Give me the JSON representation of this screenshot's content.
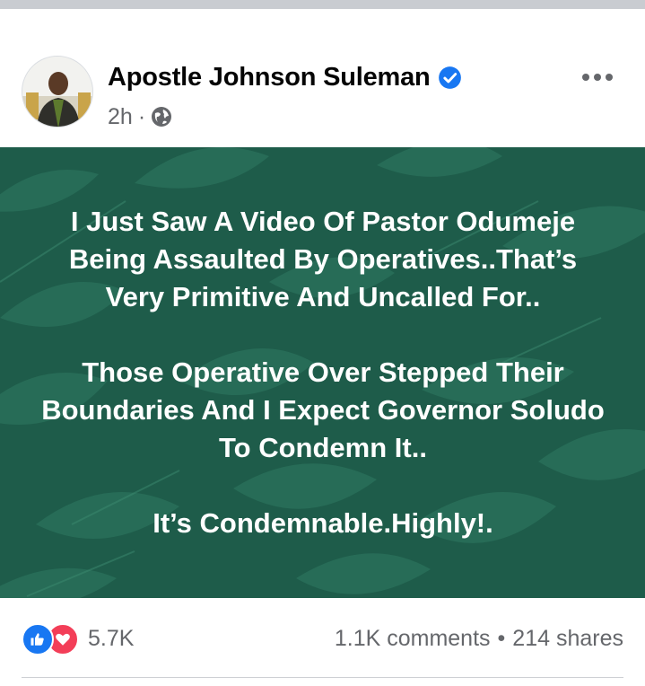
{
  "post": {
    "author": "Apostle Johnson Suleman",
    "time": "2h",
    "separator": "·",
    "more_label": "•••",
    "verified_icon": "verified-badge-icon",
    "privacy_icon": "globe-icon",
    "background_color": "#1e5c4a",
    "text_paragraphs": [
      "I Just Saw A Video Of Pastor Odumeje Being Assaulted By Operatives..That’s Very Primitive And Uncalled For..",
      "Those Operative Over Stepped Their Boundaries And I Expect Governor Soludo To Condemn It..",
      "It’s Condemnable.Highly!."
    ]
  },
  "footer": {
    "reaction_count": "5.7K",
    "comments": "1.1K comments",
    "dot": "•",
    "shares": "214 shares",
    "reaction_icons": [
      "like-icon",
      "love-icon"
    ]
  },
  "colors": {
    "accent": "#1877f2",
    "love": "#f33e58",
    "muted_text": "#65676b"
  }
}
